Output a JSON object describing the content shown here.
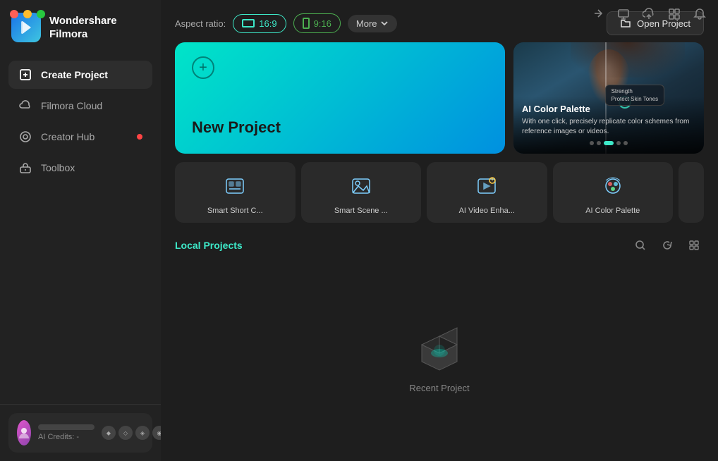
{
  "window": {
    "dots": [
      "red",
      "yellow",
      "green"
    ],
    "top_right_icons": [
      "share",
      "monitor",
      "cloud",
      "grid",
      "bell"
    ]
  },
  "logo": {
    "app_name": "Wondershare\nFilmora"
  },
  "sidebar": {
    "items": [
      {
        "id": "create-project",
        "label": "Create Project",
        "active": true,
        "dot": false
      },
      {
        "id": "filmora-cloud",
        "label": "Filmora Cloud",
        "active": false,
        "dot": false
      },
      {
        "id": "creator-hub",
        "label": "Creator Hub",
        "active": false,
        "dot": true
      },
      {
        "id": "toolbox",
        "label": "Toolbox",
        "active": false,
        "dot": false
      }
    ]
  },
  "profile": {
    "credits_label": "AI Credits: -"
  },
  "top_bar": {
    "aspect_ratio_label": "Aspect ratio:",
    "btn_16_9": "16:9",
    "btn_9_16": "9:16",
    "more_label": "More",
    "open_project_label": "Open Project"
  },
  "new_project": {
    "title": "New Project"
  },
  "feature_card": {
    "title": "AI Color Palette",
    "description": "With one click, precisely replicate color schemes from reference images or videos.",
    "strength_label": "Strength",
    "protect_skin_label": "Protect Skin Tones"
  },
  "ai_tools": [
    {
      "id": "smart-short",
      "label": "Smart Short C..."
    },
    {
      "id": "smart-scene",
      "label": "Smart Scene ..."
    },
    {
      "id": "ai-video-enhance",
      "label": "AI Video Enha..."
    },
    {
      "id": "ai-color-palette",
      "label": "AI Color Palette"
    }
  ],
  "local_projects": {
    "title": "Local Projects",
    "empty_label": "Recent Project"
  },
  "dots_indicator": [
    "",
    "",
    "active",
    "",
    ""
  ]
}
